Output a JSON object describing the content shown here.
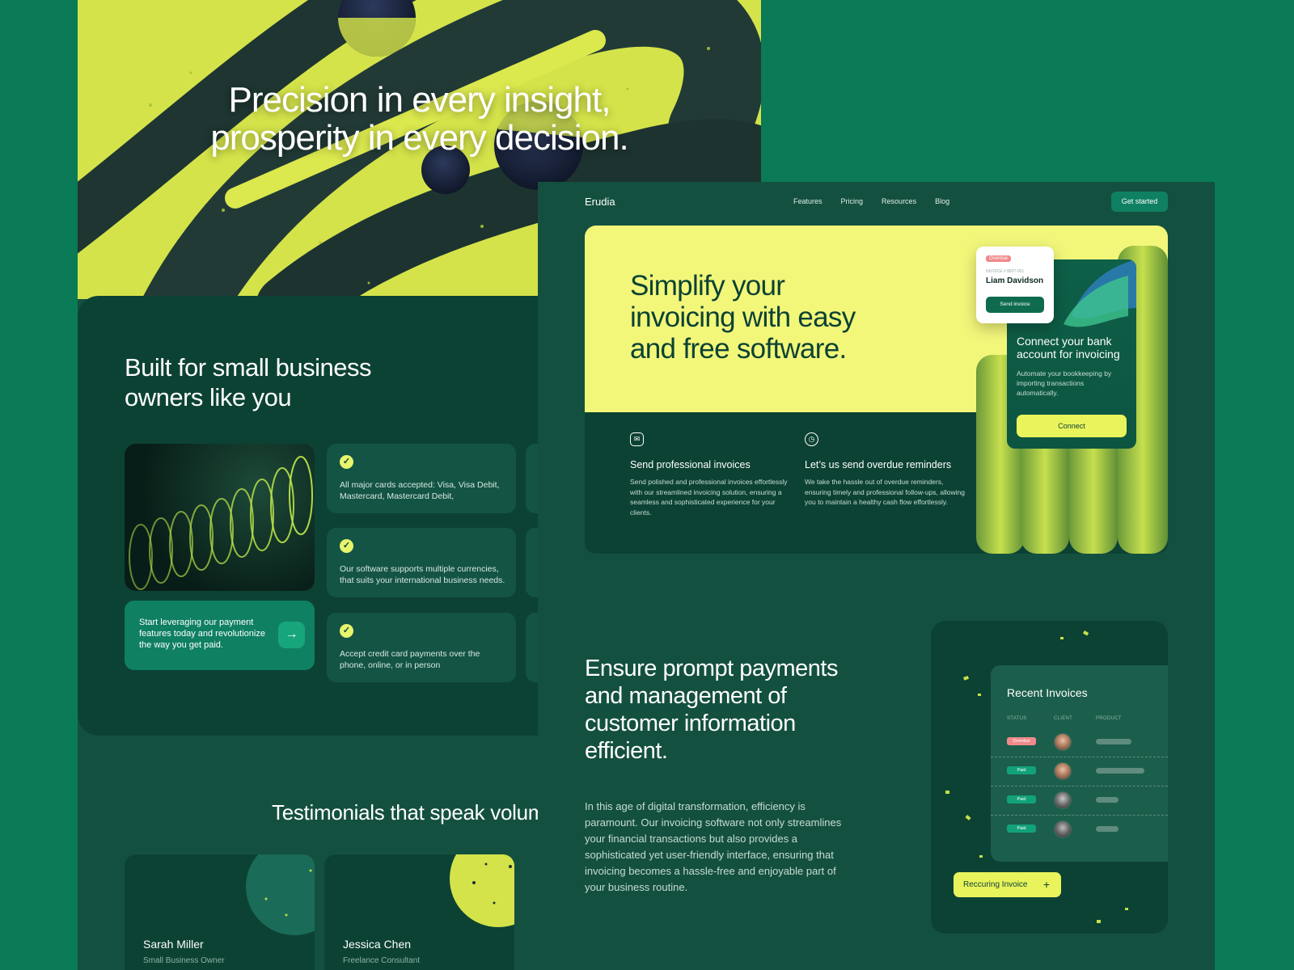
{
  "back": {
    "hero_title": "Precision in every insight,\nprosperity in every decision.",
    "built_title": "Built for small business owners like you",
    "cta_text": "Start leveraging our payment features today and revolutionize the way you get paid.",
    "cta_arrow": "→",
    "features": [
      {
        "text": "All major cards accepted: Visa, Visa Debit, Mastercard, Mastercard Debit,"
      },
      {
        "text": "Our software supports multiple currencies, that suits your international business needs."
      },
      {
        "text": "Accept credit card payments over the phone, online, or in person"
      }
    ],
    "check_glyph": "✓",
    "testimonials_title": "Testimonials that speak volum",
    "testimonials": [
      {
        "name": "Sarah Miller",
        "role": "Small Business Owner"
      },
      {
        "name": "Jessica Chen",
        "role": "Freelance Consultant"
      }
    ]
  },
  "front": {
    "nav": {
      "logo": "Erudia",
      "links": [
        "Features",
        "Pricing",
        "Resources",
        "Blog"
      ],
      "cta": "Get started"
    },
    "hero": {
      "title": "Simplify your invoicing with easy and free software.",
      "features": [
        {
          "icon": "invoice-icon",
          "title": "Send professional invoices",
          "desc": "Send polished and professional invoices effortlessly with our streamlined invoicing solution, ensuring a seamless and sophisticated experience for your clients."
        },
        {
          "icon": "clock-icon",
          "title": "Let’s us send overdue reminders",
          "desc": "We take the hassle out of overdue reminders, ensuring timely and professional follow-ups, allowing you to maintain a healthy cash flow effortlessly."
        }
      ],
      "mini_invoice": {
        "badge": "Overdue",
        "number": "INVOICE # 8837-001",
        "name": "Liam Davidson",
        "button": "Send invoice"
      },
      "bank_card": {
        "title": "Connect your bank account for invoicing",
        "desc": "Automate your bookkeeping by importing transactions automatically.",
        "button": "Connect"
      }
    },
    "section2": {
      "title": "Ensure prompt payments and management of customer information efficient.",
      "body": "In this age of digital transformation, efficiency is paramount. Our invoicing software not only streamlines your financial transactions but also provides a sophisticated yet user-friendly interface, ensuring that invoicing becomes a hassle-free and enjoyable part of your business routine."
    },
    "invoices": {
      "title": "Recent Invoices",
      "columns": [
        "STATUS",
        "CLIENT",
        "PRODUCT"
      ],
      "rows": [
        {
          "status": "Overdue",
          "bar": 0.55
        },
        {
          "status": "Paid",
          "bar": 0.75
        },
        {
          "status": "Paid",
          "bar": 0.35
        },
        {
          "status": "Paid",
          "bar": 0.35
        }
      ],
      "recurring_button": "Reccuring Invoice",
      "plus": "+"
    }
  },
  "colors": {
    "background": "#0a7a57",
    "panel": "#0c4234",
    "accent_yellow": "#f2f77a",
    "accent_green": "#0f8062"
  }
}
